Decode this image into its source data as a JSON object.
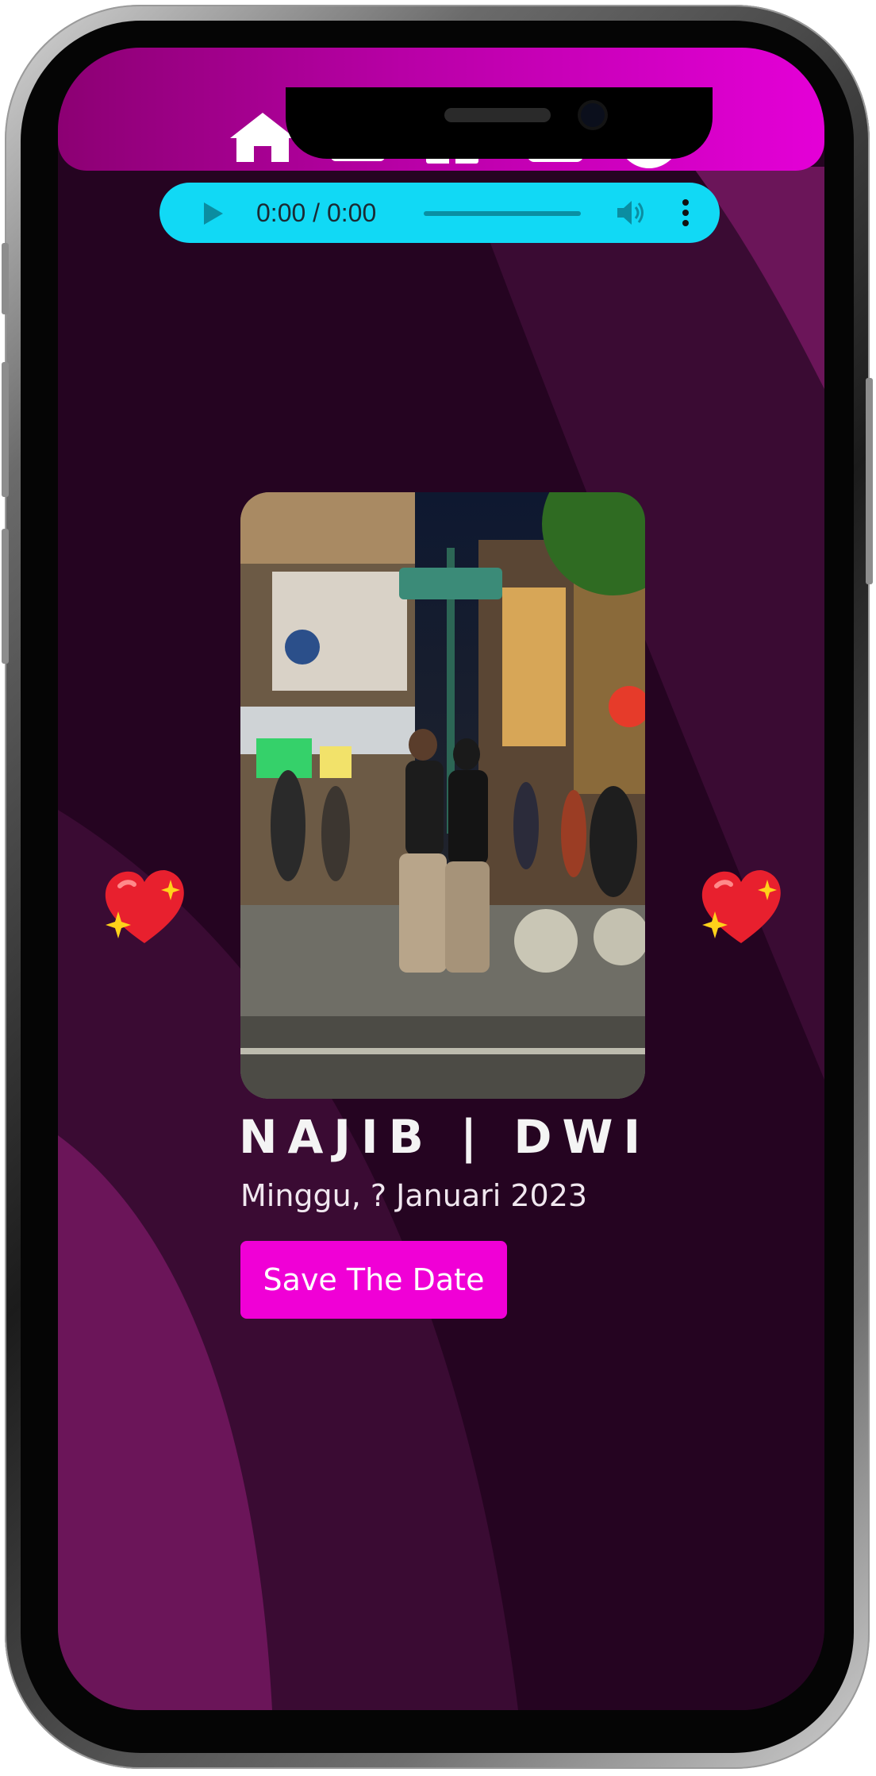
{
  "nav": {
    "items": [
      "home-icon",
      "calendar-grid-icon",
      "gift-icon",
      "calendar-icon",
      "compass-icon"
    ]
  },
  "audio": {
    "time": "0:00 / 0:00"
  },
  "couple": {
    "names": "NAJIB | DWI",
    "date": "Minggu, ? Januari 2023"
  },
  "actions": {
    "save_label": "Save The Date"
  },
  "colors": {
    "nav_gradient_start": "#8c0073",
    "nav_gradient_end": "#e400d7",
    "audio_bg": "#11d9f5",
    "button_bg": "#f000d6",
    "background_dark": "#250421",
    "background_wave": "#6b1559"
  }
}
